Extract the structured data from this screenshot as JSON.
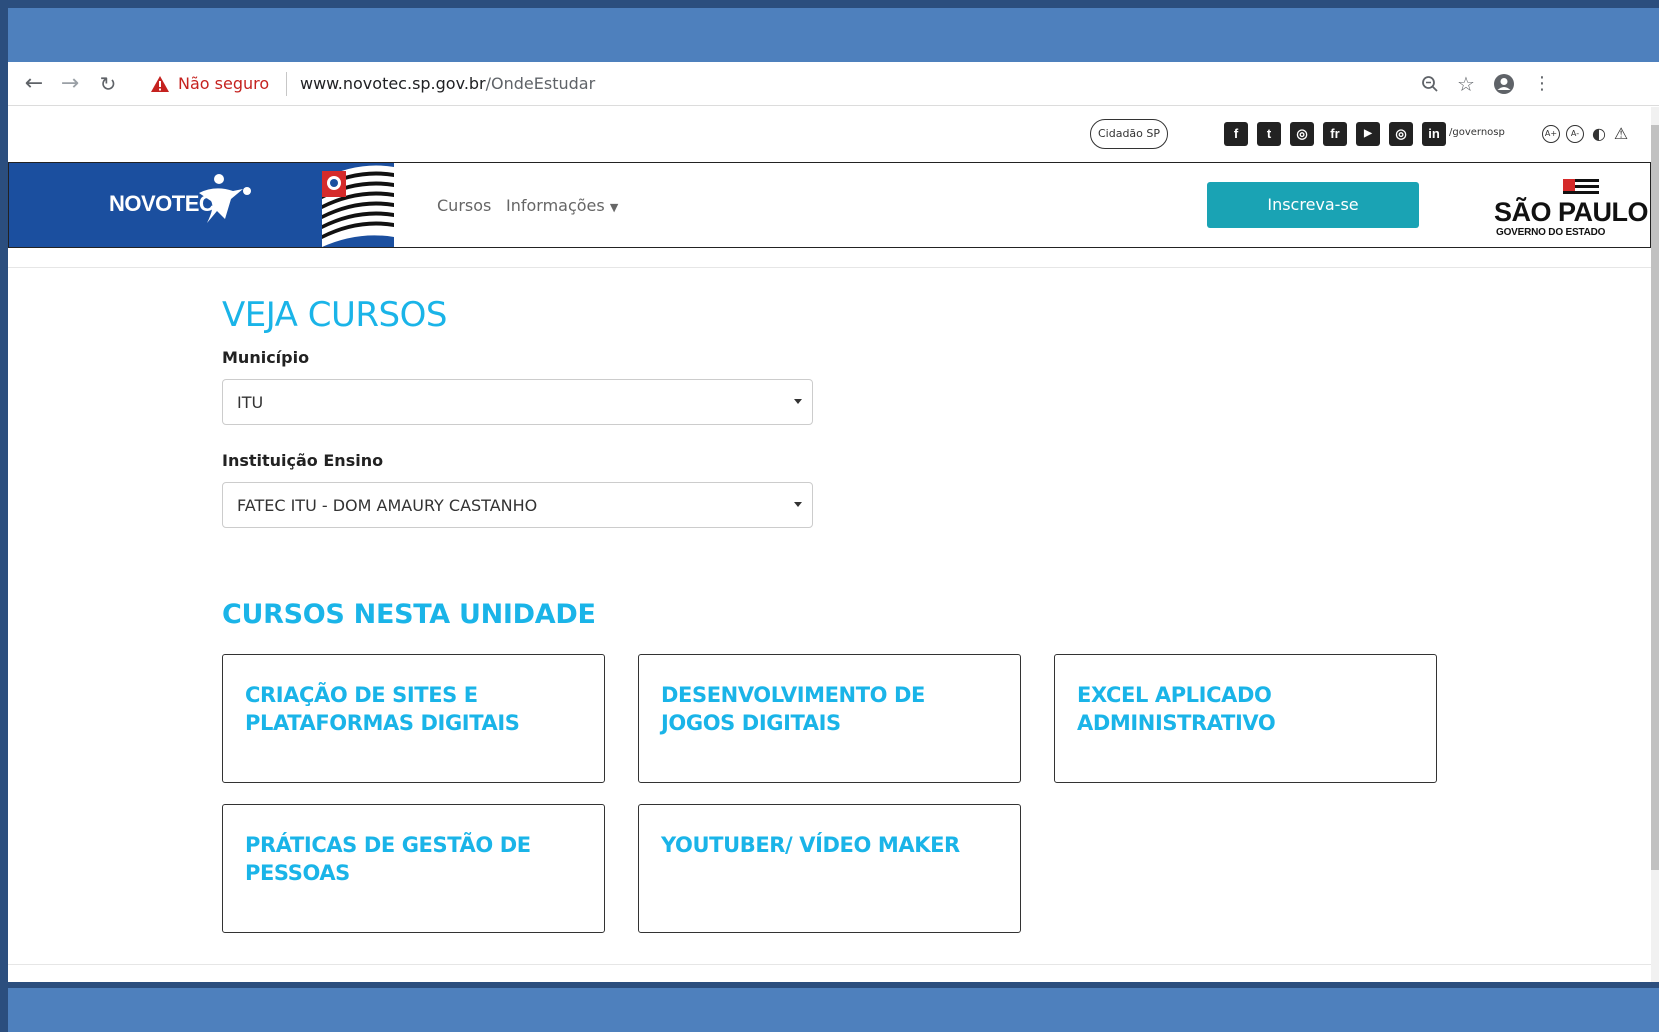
{
  "browser": {
    "not_secure_label": "Não seguro",
    "url_host": "www.novotec.sp.gov.br",
    "url_path": "/OndeEstudar",
    "icons": [
      "back-icon",
      "forward-icon",
      "reload-icon",
      "warning-icon",
      "zoom-icon",
      "star-icon",
      "account-icon",
      "menu-icon"
    ]
  },
  "utility_bar": {
    "cidadao_label": "Cidadão SP",
    "social": [
      {
        "name": "facebook",
        "glyph": "f"
      },
      {
        "name": "twitter",
        "glyph": "t"
      },
      {
        "name": "instagram",
        "glyph": "◎"
      },
      {
        "name": "flickr",
        "glyph": "fr"
      },
      {
        "name": "youtube",
        "glyph": "▶"
      },
      {
        "name": "periscope",
        "glyph": "◎"
      },
      {
        "name": "linkedin",
        "glyph": "in"
      }
    ],
    "handle": "/governosp",
    "accessibility": [
      "A+",
      "A-",
      "◐",
      "⚠"
    ]
  },
  "header": {
    "brand_name": "NOVOTEC",
    "nav": {
      "cursos": "Cursos",
      "informacoes": "Informações"
    },
    "cta": "Inscreva-se",
    "sp_title": "SÃO PAULO",
    "sp_subtitle": "GOVERNO DO ESTADO"
  },
  "main": {
    "title": "VEJA CURSOS",
    "municipio_label": "Município",
    "municipio_value": "ITU",
    "instituicao_label": "Instituição Ensino",
    "instituicao_value": "FATEC ITU - DOM AMAURY CASTANHO",
    "cursos_title": "CURSOS NESTA UNIDADE",
    "courses": [
      "CRIAÇÃO DE SITES E PLATAFORMAS DIGITAIS",
      "DESENVOLVIMENTO DE JOGOS DIGITAIS",
      "EXCEL APLICADO ADMINISTRATIVO",
      "PRÁTICAS DE GESTÃO DE PESSOAS",
      "YOUTUBER/ VÍDEO MAKER"
    ]
  },
  "colors": {
    "accent": "#1ab4e8",
    "cta": "#1aa3b4",
    "brand_blue": "#1b4f9f",
    "frame_blue": "#4e80bd",
    "not_secure_red": "#c5221f"
  }
}
